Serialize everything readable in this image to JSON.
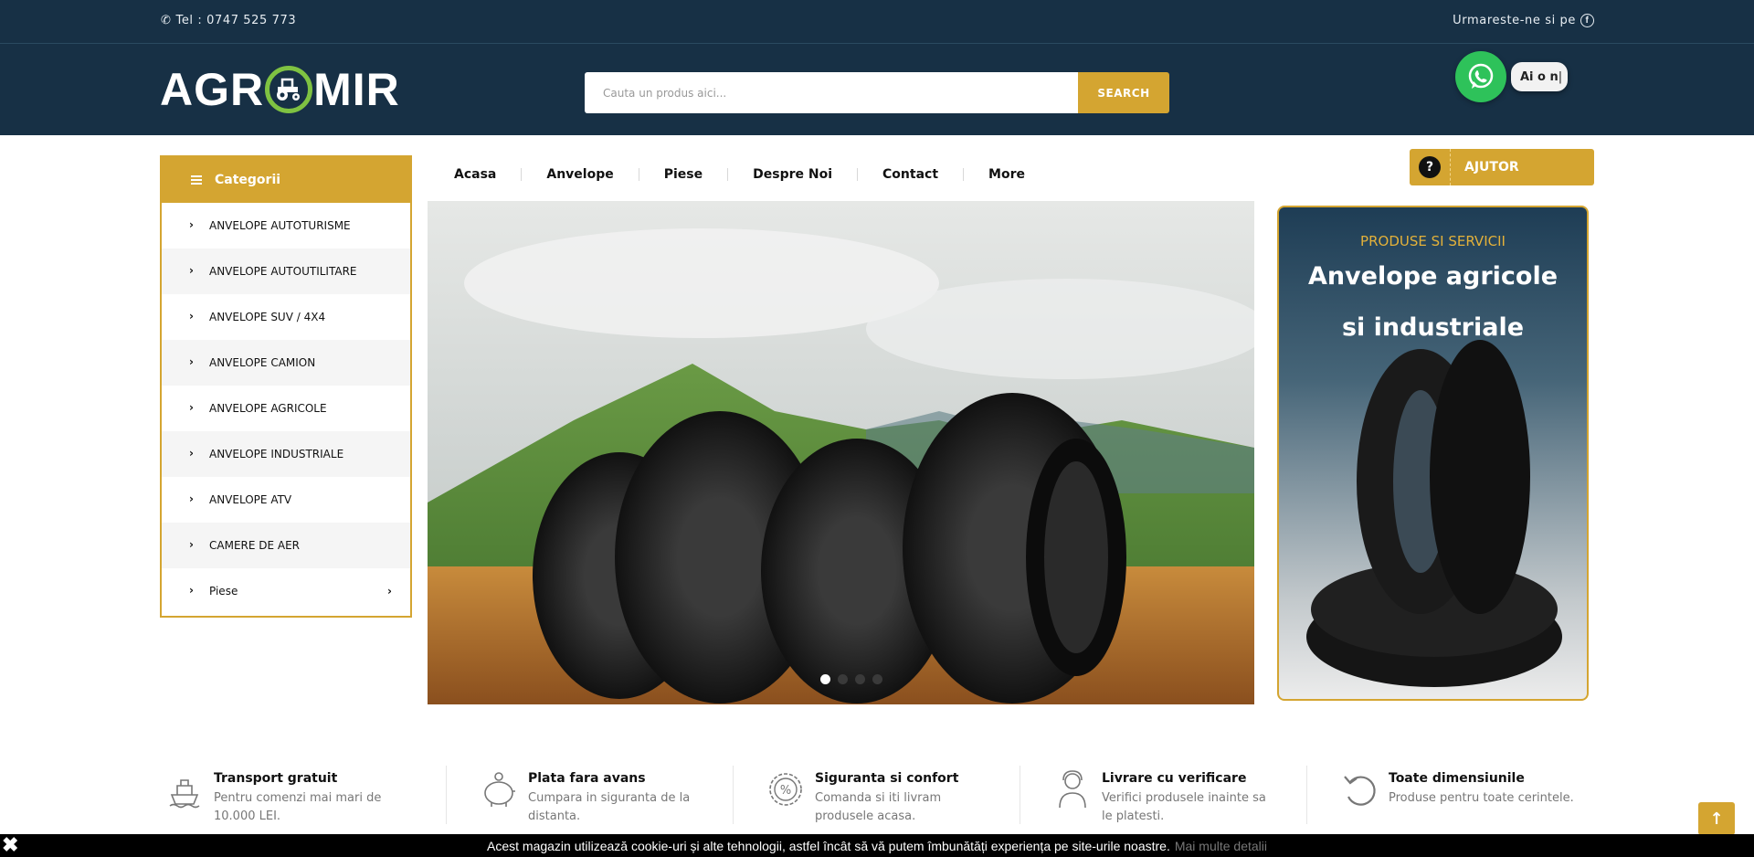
{
  "topbar": {
    "phone": "Tel : 0747 525 773",
    "follow": "Urmareste-ne si pe"
  },
  "header": {
    "logo_left": "AGR",
    "logo_right": "MIR",
    "search_placeholder": "Cauta un produs aici...",
    "search_button": "SEARCH",
    "whatsapp_bubble": "Ai o n"
  },
  "categories": {
    "title": "Categorii",
    "items": [
      "ANVELOPE AUTOTURISME",
      "ANVELOPE AUTOUTILITARE",
      "ANVELOPE SUV / 4X4",
      "ANVELOPE CAMION",
      "ANVELOPE AGRICOLE",
      "ANVELOPE INDUSTRIALE",
      "ANVELOPE ATV",
      "CAMERE DE AER",
      "Piese"
    ]
  },
  "nav": [
    "Acasa",
    "Anvelope",
    "Piese",
    "Despre Noi",
    "Contact",
    "More"
  ],
  "help": {
    "label": "AJUTOR"
  },
  "hero": {
    "active_slide": 1,
    "slide_count": 4
  },
  "side_banner": {
    "pretitle": "PRODUSE SI SERVICII",
    "title_line1": "Anvelope agricole",
    "title_line2": "si industriale"
  },
  "features": [
    {
      "title": "Transport gratuit",
      "desc1": "Pentru comenzi mai mari de",
      "desc2": "10.000 LEI."
    },
    {
      "title": "Plata fara avans",
      "desc1": "Cumpara in siguranta de la",
      "desc2": "distanta."
    },
    {
      "title": "Siguranta si confort",
      "desc1": "Comanda si iti livram",
      "desc2": "produsele acasa."
    },
    {
      "title": "Livrare cu verificare",
      "desc1": "Verifici produsele inainte sa",
      "desc2": "le platesti."
    },
    {
      "title": "Toate dimensiunile",
      "desc1": "Produse pentru toate cerintele.",
      "desc2": ""
    }
  ],
  "cookie": {
    "text": "Acest magazin utilizează cookie-uri și alte tehnologii, astfel încât să vă putem îmbunătăți experiența pe site-urile noastre.",
    "more": "Mai multe detalii"
  },
  "colors": {
    "navy": "#173045",
    "gold": "#d4a531",
    "green": "#7fc242",
    "whatsapp": "#2ec25a"
  }
}
